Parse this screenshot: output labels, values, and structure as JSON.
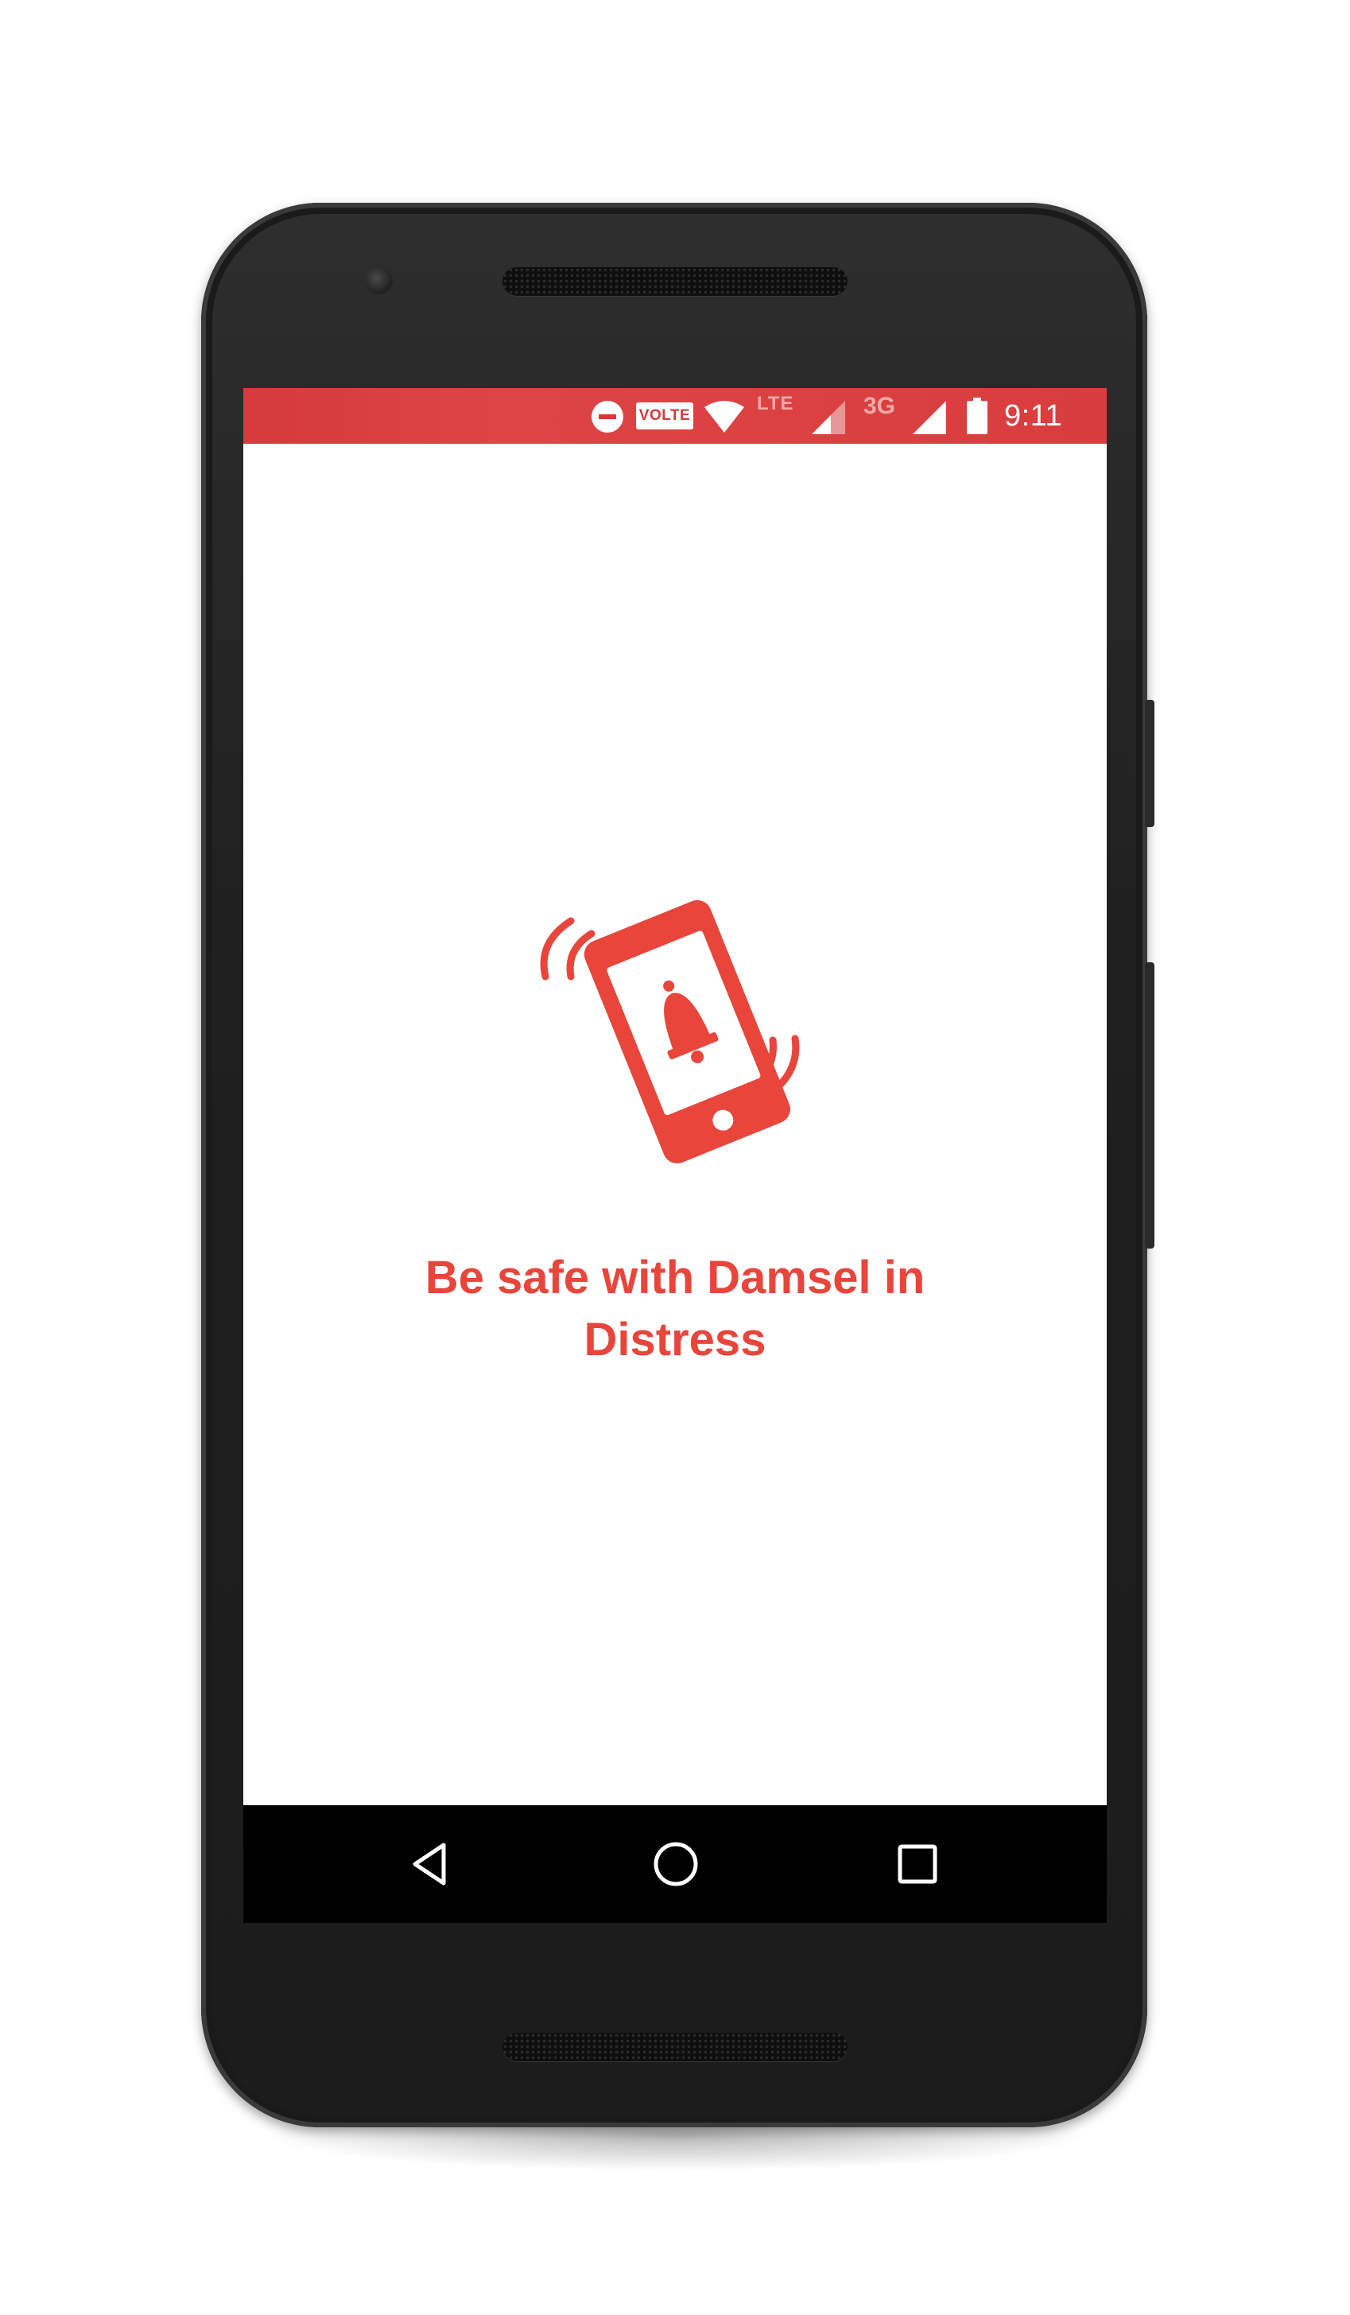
{
  "status_bar": {
    "volte_label": "VOLTE",
    "lte_label": "LTE",
    "network_3g_label": "3G",
    "time": "9:11",
    "icons": [
      "do-not-disturb-icon",
      "volte-icon",
      "wifi-icon",
      "lte-icon",
      "signal-icon",
      "3g-icon",
      "signal-icon",
      "battery-icon"
    ],
    "background_color": "#d93d3d"
  },
  "app": {
    "logo_icon": "phone-alarm-bell-icon",
    "tagline_line1": "Be safe with Damsel in",
    "tagline_line2": "Distress",
    "accent_color": "#e8453b"
  },
  "nav_bar": {
    "buttons": [
      "back-icon",
      "home-icon",
      "recents-icon"
    ]
  }
}
